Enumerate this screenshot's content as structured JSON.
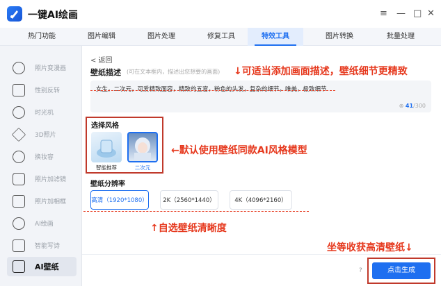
{
  "app": {
    "title": "一键AI绘画"
  },
  "window_controls": {
    "menu": "≡",
    "minimize": "—",
    "maximize": "□",
    "close": "✕"
  },
  "tabs": [
    {
      "label": "热门功能"
    },
    {
      "label": "图片编辑"
    },
    {
      "label": "图片处理"
    },
    {
      "label": "修复工具"
    },
    {
      "label": "特效工具",
      "active": true
    },
    {
      "label": "图片转换"
    },
    {
      "label": "批量处理"
    }
  ],
  "sidebar": [
    {
      "label": "照片变漫画",
      "icon": "portrait-cartoon-icon"
    },
    {
      "label": "性别反转",
      "icon": "gender-swap-icon"
    },
    {
      "label": "时光机",
      "icon": "clock-icon"
    },
    {
      "label": "3D照片",
      "icon": "3d-layers-icon"
    },
    {
      "label": "换妆容",
      "icon": "makeup-icon"
    },
    {
      "label": "照片加滤镜",
      "icon": "filter-icon"
    },
    {
      "label": "照片加相框",
      "icon": "frame-icon"
    },
    {
      "label": "AI绘画",
      "icon": "ai-paint-icon"
    },
    {
      "label": "智能写诗",
      "icon": "poem-icon"
    },
    {
      "label": "AI壁纸",
      "icon": "wallpaper-icon",
      "active": true
    }
  ],
  "main": {
    "back_label": "< 返回",
    "desc_label": "壁纸描述",
    "desc_hint": "(可在文本框内，描述出您想要的画面)",
    "prompt_text": "女生，二次元，可爱精致面容，精致的五官，粉色的头发，复杂的细节，唯美，极致细节",
    "char_count": "41",
    "char_max": "/300",
    "style_label": "选择风格",
    "styles": [
      {
        "caption": "智能推荐"
      },
      {
        "caption": "二次元",
        "selected": true
      }
    ],
    "res_label": "壁纸分辨率",
    "resolutions": [
      {
        "label": "高清（1920*1080）",
        "active": true
      },
      {
        "label": "2K（2560*1440）"
      },
      {
        "label": "4K（4096*2160）"
      }
    ],
    "generate_label": "点击生成",
    "help_icon": "?"
  },
  "annotations": {
    "note_desc": "↓可适当添加画面描述，壁纸细节更精致",
    "note_style": "←默认使用壁纸同款AI风格模型",
    "note_res": "↑自选壁纸清晰度",
    "note_gen": "坐等收获高清壁纸↓"
  },
  "colors": {
    "accent": "#1e6ff0",
    "annotation_red": "#e6391e"
  }
}
